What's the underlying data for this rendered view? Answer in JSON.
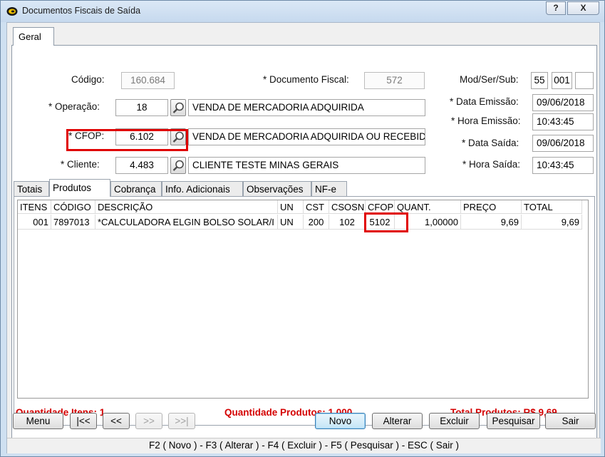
{
  "window": {
    "title": "Documentos Fiscais de Saída",
    "help_label": "?",
    "close_label": "X"
  },
  "tabs": {
    "geral": "Geral"
  },
  "form": {
    "codigo_label": "Código:",
    "codigo_value": "160.684",
    "doc_fiscal_label": "* Documento Fiscal:",
    "doc_fiscal_value": "572",
    "modsersub_label": "Mod/Ser/Sub:",
    "mod_value": "55",
    "ser_value": "001",
    "sub_value": "",
    "operacao_label": "* Operação:",
    "operacao_code": "18",
    "operacao_desc": "VENDA DE MERCADORIA ADQUIRIDA",
    "data_emissao_label": "* Data Emissão:",
    "data_emissao_value": "09/06/2018",
    "hora_emissao_label": "* Hora Emissão:",
    "hora_emissao_value": "10:43:45",
    "cfop_label": "* CFOP:",
    "cfop_code": "6.102",
    "cfop_desc": "VENDA DE MERCADORIA ADQUIRIDA OU RECEBIDA",
    "data_saida_label": "* Data Saída:",
    "data_saida_value": "09/06/2018",
    "cliente_label": "* Cliente:",
    "cliente_code": "4.483",
    "cliente_desc": "CLIENTE TESTE MINAS GERAIS",
    "hora_saida_label": "* Hora Saída:",
    "hora_saida_value": "10:43:45"
  },
  "inner_tabs": [
    "Totais",
    "Produtos",
    "Cobrança",
    "Info. Adicionais",
    "Observações",
    "NF-e"
  ],
  "grid": {
    "headers": [
      "ITENS",
      "CÓDIGO",
      "DESCRIÇÃO",
      "UN",
      "CST",
      "CSOSN",
      "CFOP",
      "QUANT.",
      "PREÇO",
      "TOTAL"
    ],
    "rows": [
      [
        "001",
        "7897013",
        "*CALCULADORA ELGIN BOLSO SOLAR/I",
        "UN",
        "200",
        "102",
        "5102",
        "1,00000",
        "9,69",
        "9,69"
      ]
    ]
  },
  "summary": {
    "qtd_itens": "Quantidade Itens: 1",
    "qtd_produtos": "Quantidade Produtos: 1,000",
    "total_produtos": "Total Produtos: R$ 9,69"
  },
  "buttons": {
    "menu": "Menu",
    "first": "|<<",
    "prev": "<<",
    "next": ">>",
    "last": ">>|",
    "novo": "Novo",
    "alterar": "Alterar",
    "excluir": "Excluir",
    "pesquisar": "Pesquisar",
    "sair": "Sair"
  },
  "shortcuts": "F2 ( Novo )  -  F3 ( Alterar )  -  F4 ( Excluir )  -  F5 ( Pesquisar )  -  ESC ( Sair )",
  "colors": {
    "highlight": "#e00000",
    "summary_text": "#d40000",
    "window_frame": "#cfe0f1"
  }
}
